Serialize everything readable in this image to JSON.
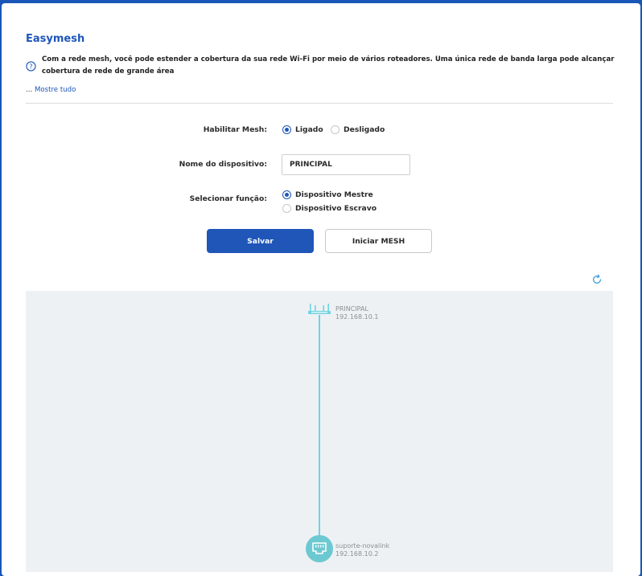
{
  "header": {
    "title": "Easymesh",
    "description": "Com a rede mesh, você pode estender a cobertura da sua rede Wi-Fi por meio de vários roteadores. Uma única rede de banda larga pode alcançar cobertura de rede de grande área",
    "show_all_prefix": "...",
    "show_all_label": "Mostre tudo"
  },
  "form": {
    "enable_mesh": {
      "label": "Habilitar Mesh",
      "options": [
        "Ligado",
        "Desligado"
      ],
      "selected": "Ligado"
    },
    "device_name": {
      "label": "Nome do dispositivo",
      "value": "PRINCIPAL"
    },
    "role": {
      "label": "Selecionar função",
      "options": [
        "Dispositivo Mestre",
        "Dispositivo Escravo"
      ],
      "selected": "Dispositivo Mestre"
    },
    "colon": ":",
    "save_label": "Salvar",
    "start_mesh_label": "Iniciar MESH"
  },
  "topology": {
    "master": {
      "name": "PRINCIPAL",
      "ip": "192.168.10.1",
      "icon": "router-icon"
    },
    "satellite": {
      "name": "suporte-novalink",
      "ip": "192.168.10.2",
      "icon": "ethernet-node-icon"
    },
    "refresh_icon": "refresh-icon"
  },
  "colors": {
    "accent": "#1f56b8",
    "link_line": "#6fd3e2",
    "satellite_node": "#6cc9d1",
    "topology_bg": "#eef1f4"
  }
}
